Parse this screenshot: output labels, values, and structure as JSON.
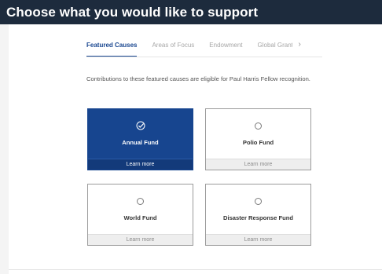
{
  "header": {
    "title": "Choose what you would like to support"
  },
  "tabs": [
    {
      "label": "Featured Causes",
      "active": true
    },
    {
      "label": "Areas of Focus",
      "active": false
    },
    {
      "label": "Endowment",
      "active": false
    },
    {
      "label": "Global Grants",
      "active": false
    }
  ],
  "tabs_more_icon": "chevron-right-icon",
  "intro": "Contributions to these featured causes are eligible for Paul Harris Fellow recognition.",
  "funds": [
    {
      "name": "Annual Fund",
      "learn_more": "Learn more",
      "selected": true
    },
    {
      "name": "Polio Fund",
      "learn_more": "Learn more",
      "selected": false
    },
    {
      "name": "World Fund",
      "learn_more": "Learn more",
      "selected": false
    },
    {
      "name": "Disaster Response Fund",
      "learn_more": "Learn more",
      "selected": false
    }
  ],
  "colors": {
    "header_bg": "#1d2b3d",
    "accent": "#17458f",
    "muted_tab": "#a6a6a6"
  }
}
